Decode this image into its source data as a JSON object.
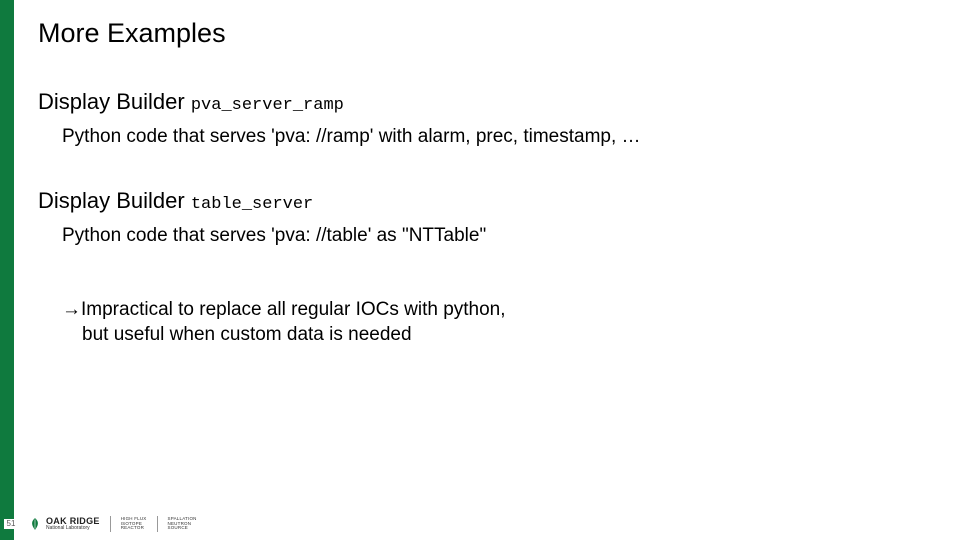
{
  "slide": {
    "title": "More Examples",
    "section1": {
      "heading_main": "Display Builder ",
      "heading_mono": "pva_server_ramp",
      "body": "Python code that serves 'pva: //ramp' with alarm, prec, timestamp, …"
    },
    "section2": {
      "heading_main": "Display Builder ",
      "heading_mono": "table_server",
      "body": "Python code that serves 'pva: //table' as \"NTTable\""
    },
    "note": {
      "arrow": "→",
      "line1": "Impractical to replace all regular IOCs with python,",
      "line2": "but useful when custom data is needed"
    }
  },
  "footer": {
    "page_number": "51",
    "oakridge_main": "OAK RIDGE",
    "oakridge_sub": "National Laboratory",
    "lab1_l1": "HIGH FLUX",
    "lab1_l2": "ISOTOPE",
    "lab1_l3": "REACTOR",
    "lab2_l1": "SPALLATION",
    "lab2_l2": "NEUTRON",
    "lab2_l3": "SOURCE"
  }
}
